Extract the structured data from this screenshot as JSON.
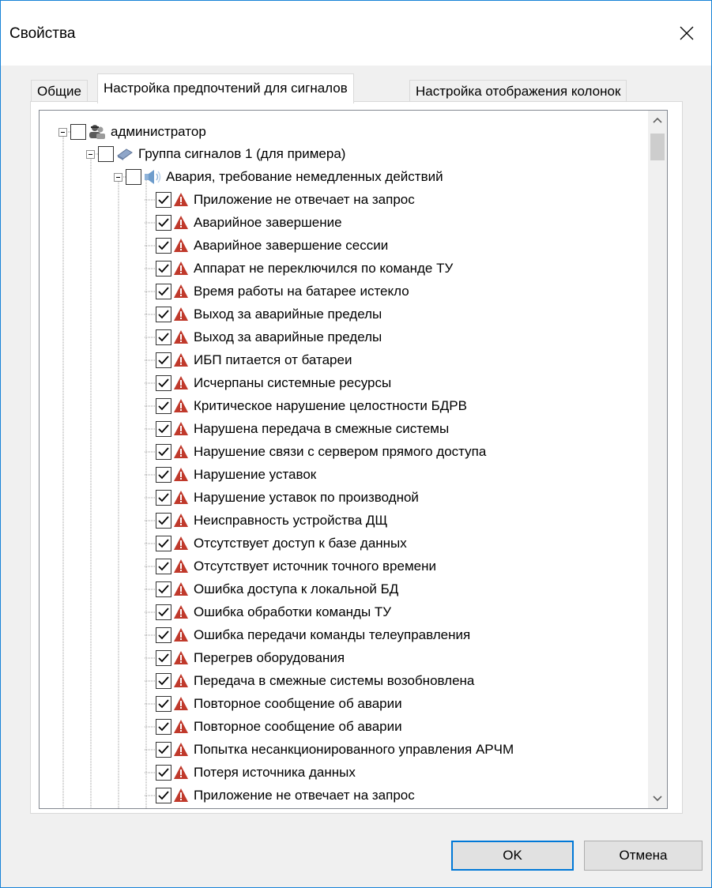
{
  "window": {
    "title": "Свойства"
  },
  "tabs": [
    {
      "label": "Общие"
    },
    {
      "label": "Настройка предпочтений для сигналов"
    },
    {
      "label": "Настройка отображения колонок"
    }
  ],
  "tree": {
    "user": {
      "label": "администратор"
    },
    "group": {
      "label": "Группа сигналов 1 (для примера)"
    },
    "category": {
      "label": "Авария, требование немедленных действий"
    },
    "signals": [
      " Приложение не отвечает на запрос",
      "Аварийное завершение",
      "Аварийное завершение сессии",
      "Аппарат не переключился по команде ТУ",
      "Время работы на батарее истекло",
      "Выход за аварийные пределы",
      "Выход за аварийные пределы",
      "ИБП питается от батареи",
      "Исчерпаны системные ресурсы",
      "Критическое нарушение целостности БДРВ",
      "Нарушена передача в смежные системы",
      "Нарушение связи с сервером прямого доступа",
      "Нарушение уставок",
      "Нарушение уставок по производной",
      "Неисправность устройства ДЩ",
      "Отсутствует доступ к базе данных",
      "Отсутствует источник точного времени",
      "Ошибка доступа к локальной БД",
      "Ошибка обработки команды ТУ",
      "Ошибка передачи команды телеуправления",
      "Перегрев оборудования",
      "Передача в смежные системы возобновлена",
      "Повторное сообщение об аварии",
      "Повторное сообщение об аварии",
      "Попытка несанкционированного управления АРЧМ",
      "Потеря источника данных",
      "Приложение не отвечает на запрос"
    ]
  },
  "buttons": {
    "ok": "OK",
    "cancel": "Отмена"
  },
  "colors": {
    "accent": "#0078d7",
    "warning": "#c0392b"
  }
}
